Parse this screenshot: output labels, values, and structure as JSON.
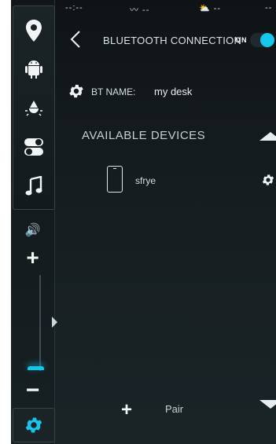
{
  "statusbar": {
    "left": "--:--",
    "wave": "〰 --",
    "weather": "⛅ --",
    "right": "--"
  },
  "rail": {
    "items": [
      {
        "icon": "location-pin-icon"
      },
      {
        "icon": "android-icon"
      },
      {
        "icon": "light-bulb-icon"
      },
      {
        "icon": "toggle-icon"
      },
      {
        "icon": "music-note-icon"
      }
    ],
    "volume_icon": "🔊",
    "volume_plus": "+",
    "volume_minus": "−",
    "volume_level": 0.05,
    "accent_color": "#18c6ec"
  },
  "header": {
    "back": "‹",
    "title": "BLUETOOTH CONNECTION",
    "toggle_label": "ON",
    "toggle_state": true
  },
  "bt": {
    "label": "BT NAME:",
    "value": "my desk"
  },
  "devices": {
    "section_title": "AVAILABLE DEVICES",
    "items": [
      {
        "name": "sfrye"
      }
    ]
  },
  "footer": {
    "pair_plus": "+",
    "pair_label": "Pair"
  }
}
